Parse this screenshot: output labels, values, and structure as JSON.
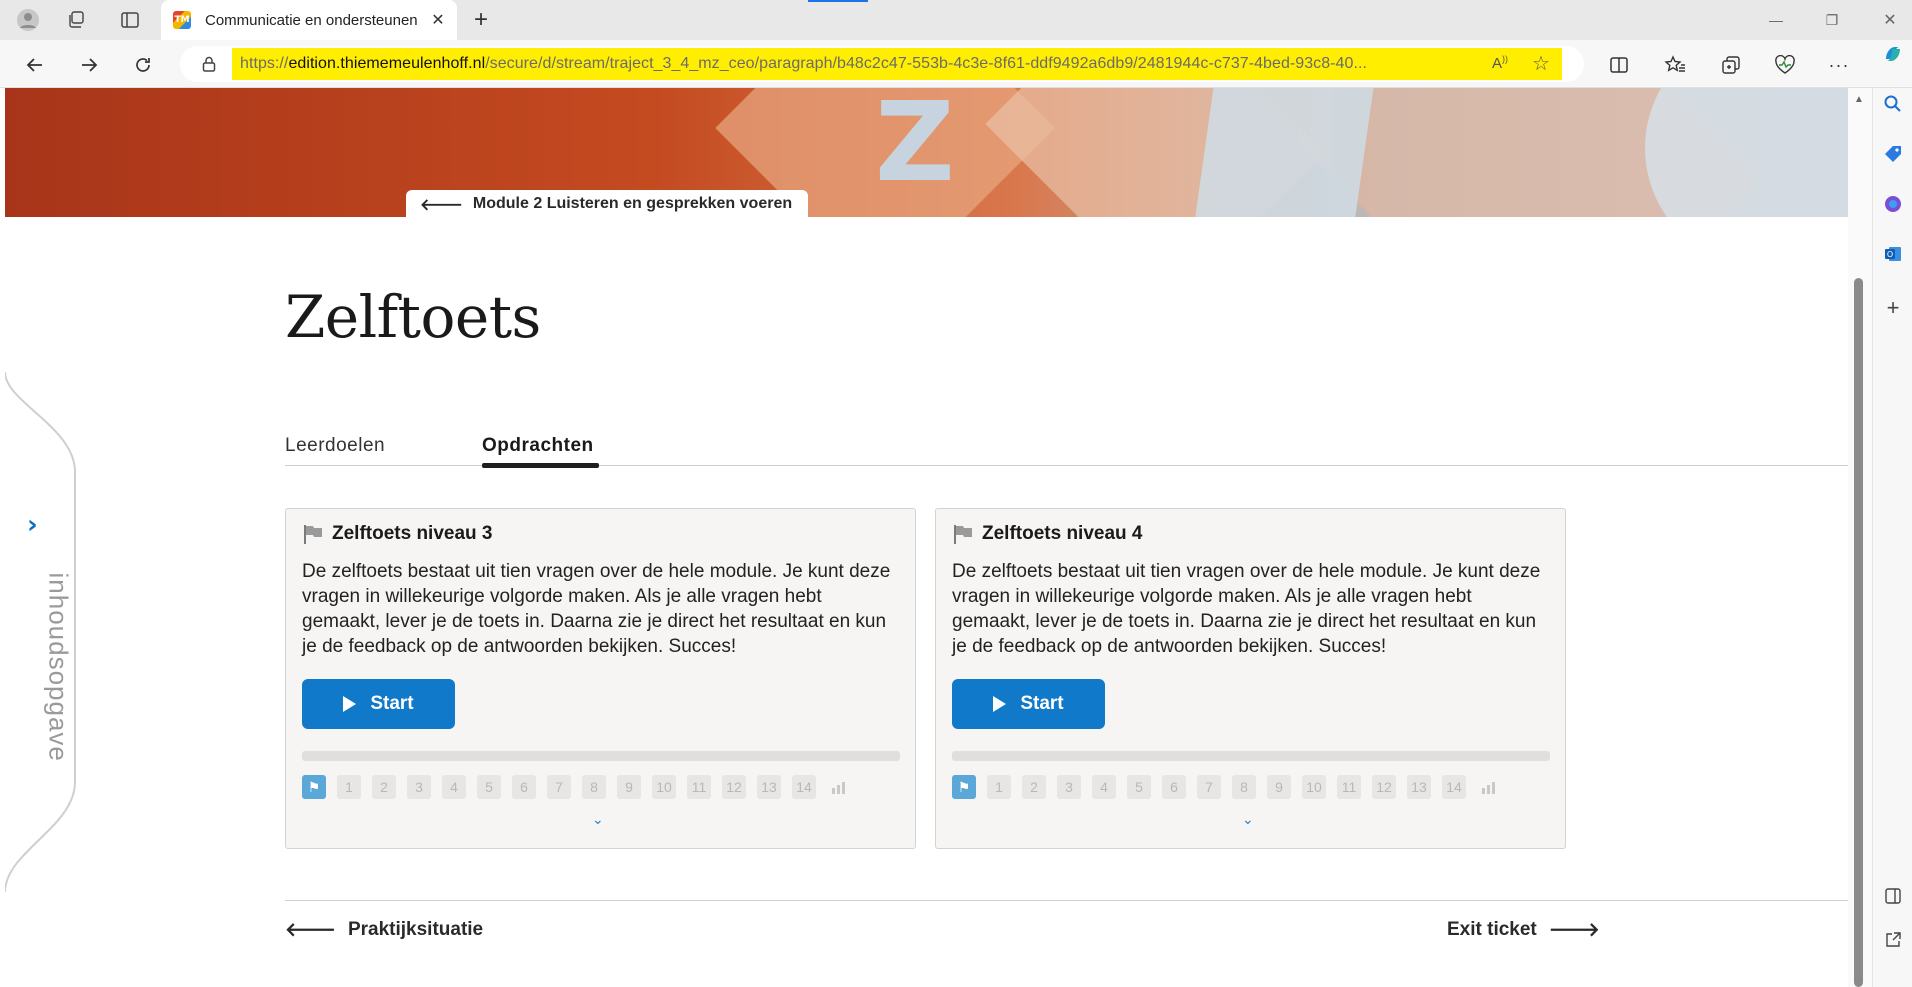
{
  "browser": {
    "tab_title": "Communicatie en ondersteunen",
    "favicon_text": "TM",
    "url_domain": "edition.thiememeulenhoff.nl",
    "url_prefix": "https://",
    "url_path": "/secure/d/stream/traject_3_4_mz_ceo/paragraph/b48c2c47-553b-4c3e-8f61-ddf9492a6db9/2481944c-c737-4bed-93c8-40...",
    "url_highlight_color": "#ffee00"
  },
  "hero": {
    "back_link": "Module 2 Luisteren en gesprekken voeren",
    "graphic_letter": "Z"
  },
  "sidebar_toc": {
    "label": "inhoudsopgave"
  },
  "page": {
    "title": "Zelftoets",
    "tabs": [
      {
        "label": "Leerdoelen",
        "active": false
      },
      {
        "label": "Opdrachten",
        "active": true
      }
    ]
  },
  "cards": [
    {
      "title": "Zelftoets niveau 3",
      "description": "De zelftoets bestaat uit tien vragen over de hele module. Je kunt deze vragen in willekeurige volgorde maken. Als je alle vragen hebt gemaakt, lever je de toets in. Daarna zie je direct het resultaat en kun je de feedback op de antwoorden bekijken. Succes!",
      "start_label": "Start",
      "progress": 0,
      "steps": [
        "1",
        "2",
        "3",
        "4",
        "5",
        "6",
        "7",
        "8",
        "9",
        "10",
        "11",
        "12",
        "13",
        "14"
      ]
    },
    {
      "title": "Zelftoets niveau 4",
      "description": "De zelftoets bestaat uit tien vragen over de hele module. Je kunt deze vragen in willekeurige volgorde maken. Als je alle vragen hebt gemaakt, lever je de toets in. Daarna zie je direct het resultaat en kun je de feedback op de antwoorden bekijken. Succes!",
      "start_label": "Start",
      "progress": 0,
      "steps": [
        "1",
        "2",
        "3",
        "4",
        "5",
        "6",
        "7",
        "8",
        "9",
        "10",
        "11",
        "12",
        "13",
        "14"
      ]
    }
  ],
  "footer": {
    "prev_label": "Praktijksituatie",
    "next_label": "Exit ticket"
  },
  "colors": {
    "accent_blue": "#1079c9",
    "step_flag": "#5aa7d8",
    "hero_orange": "#c44a20"
  },
  "icons": {
    "back": "arrow-left-icon",
    "forward": "arrow-right-icon",
    "refresh": "refresh-icon",
    "flag": "flag-icon",
    "play": "play-icon",
    "stats": "bar-chart-icon",
    "chevron_down": "chevron-down-icon",
    "chevron_right": "chevron-right-icon"
  }
}
